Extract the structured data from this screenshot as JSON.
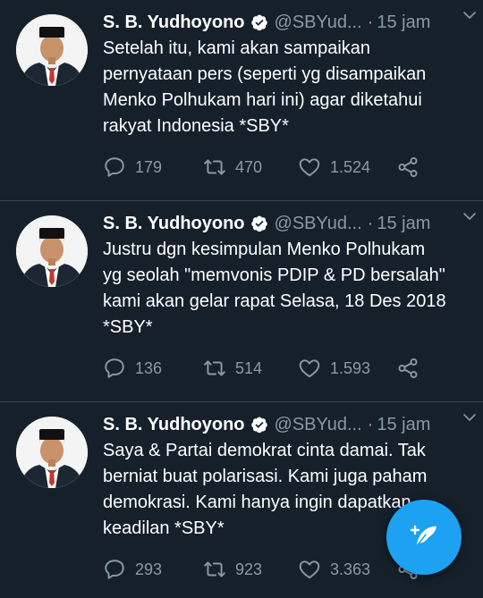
{
  "colors": {
    "background": "#15202b",
    "divider": "#38444d",
    "secondary_text": "#8899a6",
    "accent": "#1da1f2"
  },
  "tweets": [
    {
      "name": "S. B. Yudhoyono",
      "handle": "@SBYud...",
      "separator": "·",
      "time": "15 jam",
      "text": "Setelah itu, kami akan sampaikan\npernyataan pers (seperti yg disampaikan\nMenko Polhukam hari ini) agar diketahui\nrakyat Indonesia *SBY*",
      "replies": "179",
      "retweets": "470",
      "likes": "1.524"
    },
    {
      "name": "S. B. Yudhoyono",
      "handle": "@SBYud...",
      "separator": "·",
      "time": "15 jam",
      "text": "Justru dgn kesimpulan Menko Polhukam\nyg seolah \"memvonis PDIP & PD bersalah\"\nkami akan gelar rapat Selasa, 18 Des 2018\n*SBY*",
      "replies": "136",
      "retweets": "514",
      "likes": "1.593"
    },
    {
      "name": "S. B. Yudhoyono",
      "handle": "@SBYud...",
      "separator": "·",
      "time": "15 jam",
      "text": "Saya & Partai demokrat cinta damai. Tak\nberniat buat polarisasi. Kami juga paham\ndemokrasi. Kami hanya ingin dapatkan\nkeadilan *SBY*",
      "replies": "293",
      "retweets": "923",
      "likes": "3.363"
    }
  ],
  "icons": {
    "verified": "verified-badge-icon",
    "menu": "chevron-down-icon",
    "reply": "reply-icon",
    "retweet": "retweet-icon",
    "like": "heart-icon",
    "share": "share-icon",
    "compose": "compose-feather-icon"
  }
}
